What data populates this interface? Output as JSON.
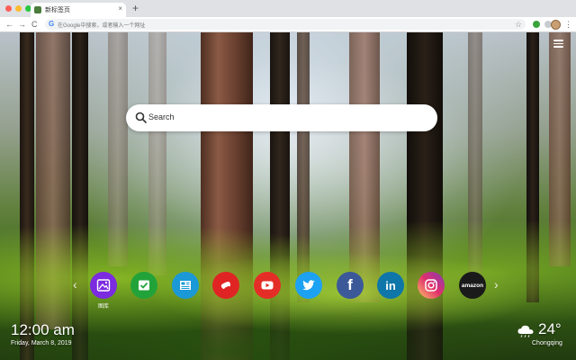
{
  "browser": {
    "tab_title": "新标签页",
    "tab_close": "×",
    "new_tab": "+",
    "back": "←",
    "forward": "→",
    "reload": "C",
    "omnibox_placeholder": "在Google中搜索，或者输入一个网址",
    "bookmark_star": "☆",
    "menu": "⋮"
  },
  "search": {
    "placeholder": "Search"
  },
  "shortcuts": {
    "prev": "‹",
    "next": "›",
    "items": [
      {
        "name": "gallery",
        "label": "图库",
        "color": "#7b2be0",
        "icon": "image-icon"
      },
      {
        "name": "tasks",
        "label": "",
        "color": "#22a33a",
        "icon": "check-icon"
      },
      {
        "name": "notes",
        "label": "",
        "color": "#1b98d6",
        "icon": "news-icon"
      },
      {
        "name": "games",
        "label": "",
        "color": "#e02424",
        "icon": "gamepad-icon"
      },
      {
        "name": "youtube",
        "label": "",
        "color": "#e52d27",
        "icon": "play-icon"
      },
      {
        "name": "twitter",
        "label": "",
        "color": "#1da1f2",
        "icon": "twitter-bird-icon"
      },
      {
        "name": "facebook",
        "label": "",
        "color": "#3b5998",
        "icon": "facebook-f-icon",
        "glyph": "f"
      },
      {
        "name": "linkedin",
        "label": "",
        "color": "#0e76a8",
        "icon": "linkedin-in-icon",
        "glyph": "in"
      },
      {
        "name": "instagram",
        "label": "",
        "color": "#d6249f",
        "icon": "camera-icon"
      },
      {
        "name": "amazon",
        "label": "",
        "color": "#1a1a1a",
        "icon": "amazon-logo-icon",
        "glyph": "amazon"
      }
    ]
  },
  "clock": {
    "time": "12:00 am",
    "date": "Friday, March 8, 2019"
  },
  "weather": {
    "temperature": "24°",
    "city": "Chongqing",
    "condition_icon": "cloud-icon"
  }
}
